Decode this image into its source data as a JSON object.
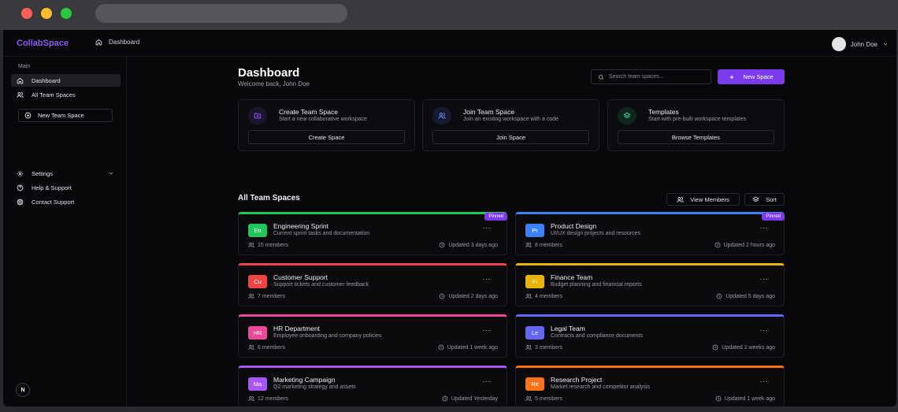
{
  "app": {
    "brand": "CollabSpace"
  },
  "breadcrumb": {
    "label": "Dashboard"
  },
  "user": {
    "name": "John Doe"
  },
  "sidebar": {
    "section": "Main",
    "items": [
      {
        "label": "Dashboard",
        "icon": "home-icon"
      },
      {
        "label": "All Team Spaces",
        "icon": "users-icon"
      }
    ],
    "new_space_label": "New Team Space",
    "settings_label": "Settings",
    "help_label": "Help & Support",
    "contact_label": "Contact Support",
    "n_badge": "N"
  },
  "header": {
    "title": "Dashboard",
    "subtitle": "Welcome back, John Doe",
    "search_placeholder": "Search team spaces...",
    "new_space_label": "New Space"
  },
  "actions": [
    {
      "title": "Create Team Space",
      "desc": "Start a new collaborative workspace",
      "button": "Create Space",
      "icon": "folder-plus-icon",
      "color": "#8b5cf6"
    },
    {
      "title": "Join Team Space",
      "desc": "Join an existing workspace with a code",
      "button": "Join Space",
      "icon": "users-icon",
      "color": "#6b8cf0"
    },
    {
      "title": "Templates",
      "desc": "Start with pre-built workspace templates",
      "button": "Browse Templates",
      "icon": "layers-icon",
      "color": "#34d399"
    }
  ],
  "spaces_section": {
    "title": "All Team Spaces",
    "view_members_label": "View Members",
    "sort_label": "Sort",
    "pinned_label": "Pinned"
  },
  "spaces": [
    {
      "abbr": "En",
      "name": "Engineering Sprint",
      "desc": "Current sprint tasks and documentation",
      "members": "15 members",
      "updated": "Updated 3 days ago",
      "color": "#22c55e",
      "pinned": true
    },
    {
      "abbr": "Pr",
      "name": "Product Design",
      "desc": "UI/UX design projects and resources",
      "members": "8 members",
      "updated": "Updated 2 hours ago",
      "color": "#3b82f6",
      "pinned": true
    },
    {
      "abbr": "Cu",
      "name": "Customer Support",
      "desc": "Support tickets and customer feedback",
      "members": "7 members",
      "updated": "Updated 2 days ago",
      "color": "#ef4444",
      "pinned": false
    },
    {
      "abbr": "Fi",
      "name": "Finance Team",
      "desc": "Budget planning and financial reports",
      "members": "4 members",
      "updated": "Updated 5 days ago",
      "color": "#eab308",
      "pinned": false
    },
    {
      "abbr": "HR",
      "name": "HR Department",
      "desc": "Employee onboarding and company policies",
      "members": "6 members",
      "updated": "Updated 1 week ago",
      "color": "#ec4899",
      "pinned": false
    },
    {
      "abbr": "Le",
      "name": "Legal Team",
      "desc": "Contracts and compliance documents",
      "members": "3 members",
      "updated": "Updated 2 weeks ago",
      "color": "#6366f1",
      "pinned": false
    },
    {
      "abbr": "Ma",
      "name": "Marketing Campaign",
      "desc": "Q2 marketing strategy and assets",
      "members": "12 members",
      "updated": "Updated Yesterday",
      "color": "#a855f7",
      "pinned": false
    },
    {
      "abbr": "Re",
      "name": "Research Project",
      "desc": "Market research and competitor analysis",
      "members": "5 members",
      "updated": "Updated 1 week ago",
      "color": "#f97316",
      "pinned": false
    }
  ]
}
